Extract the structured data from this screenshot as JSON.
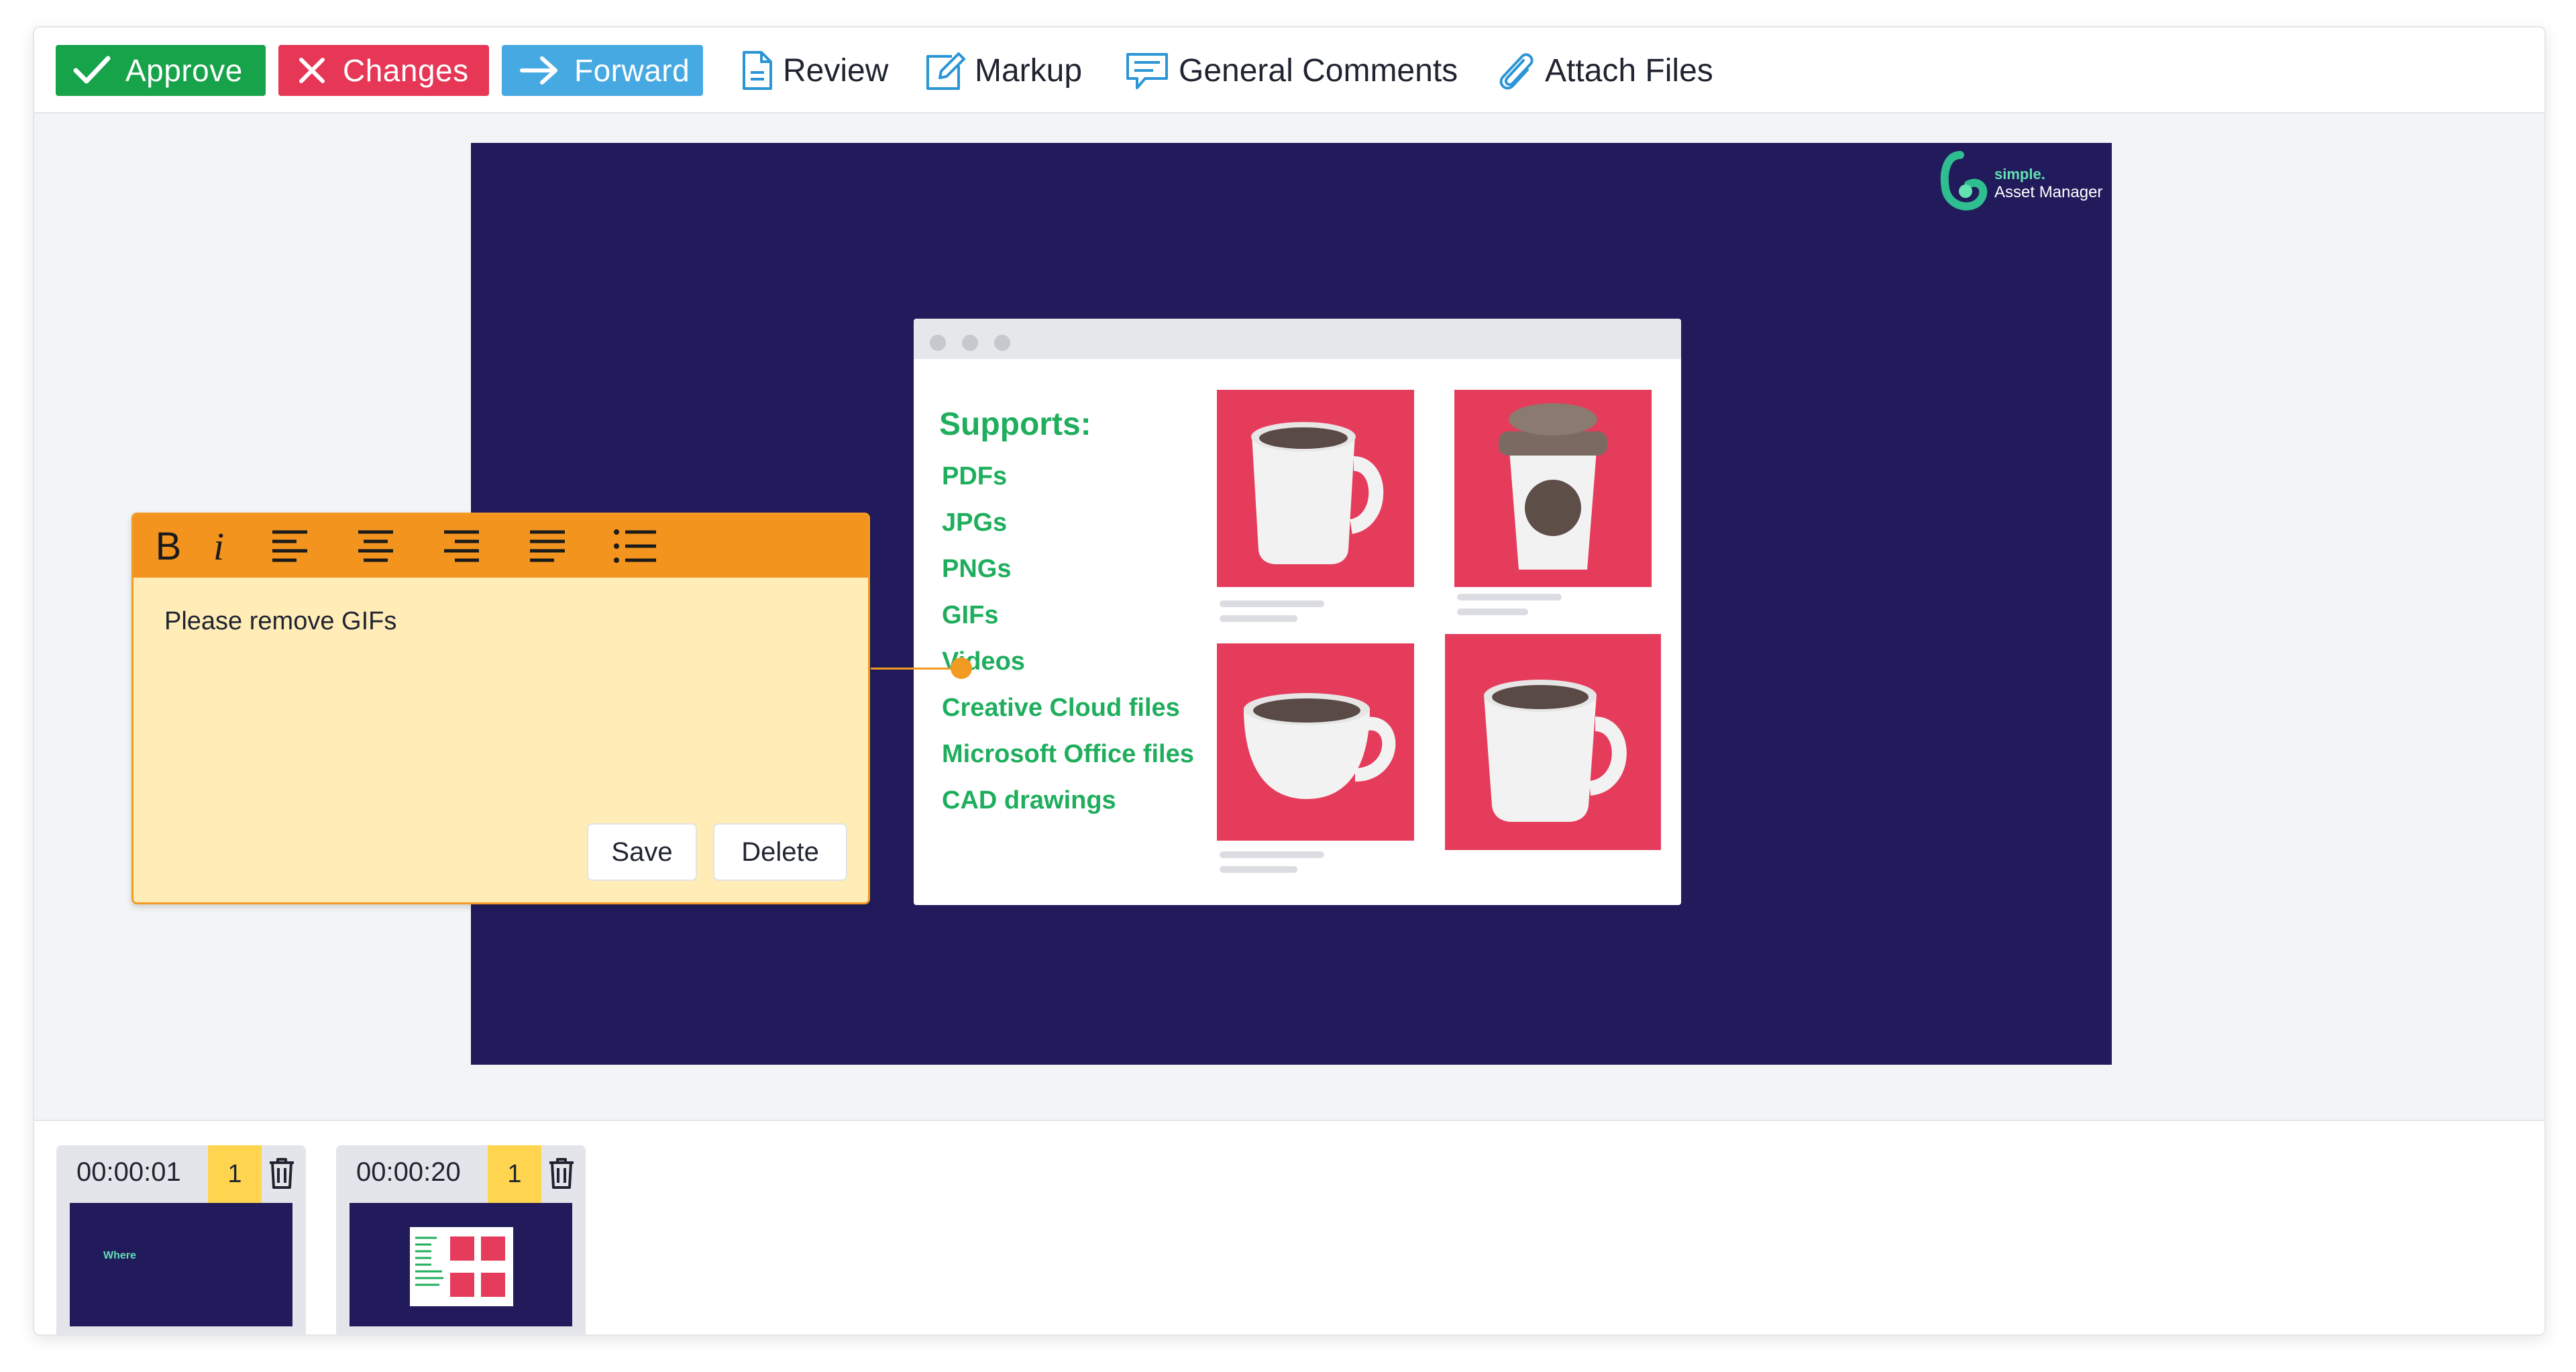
{
  "toolbar": {
    "approve_label": "Approve",
    "changes_label": "Changes",
    "forward_label": "Forward",
    "review_label": "Review",
    "markup_label": "Markup",
    "general_comments_label": "General Comments",
    "attach_files_label": "Attach Files",
    "colors": {
      "approve": "#17a34a",
      "changes": "#e73756",
      "forward": "#47a9e2"
    }
  },
  "stage": {
    "logo": {
      "top": "simple.",
      "bottom": "Asset Manager"
    },
    "supports": {
      "title": "Supports:",
      "items": [
        "PDFs",
        "JPGs",
        "PNGs",
        "GIFs",
        "Videos",
        "Creative Cloud files",
        "Microsoft Office files",
        "CAD drawings"
      ]
    }
  },
  "comment": {
    "format_tools": [
      "bold",
      "italic",
      "align-left",
      "align-center",
      "align-right",
      "justify",
      "bullet-list"
    ],
    "bold_glyph": "B",
    "italic_glyph": "i",
    "text": "Please remove GIFs",
    "save_label": "Save",
    "delete_label": "Delete"
  },
  "timeline": [
    {
      "time": "00:00:01",
      "count": "1",
      "preview_text": "Where"
    },
    {
      "time": "00:00:20",
      "count": "1"
    }
  ]
}
